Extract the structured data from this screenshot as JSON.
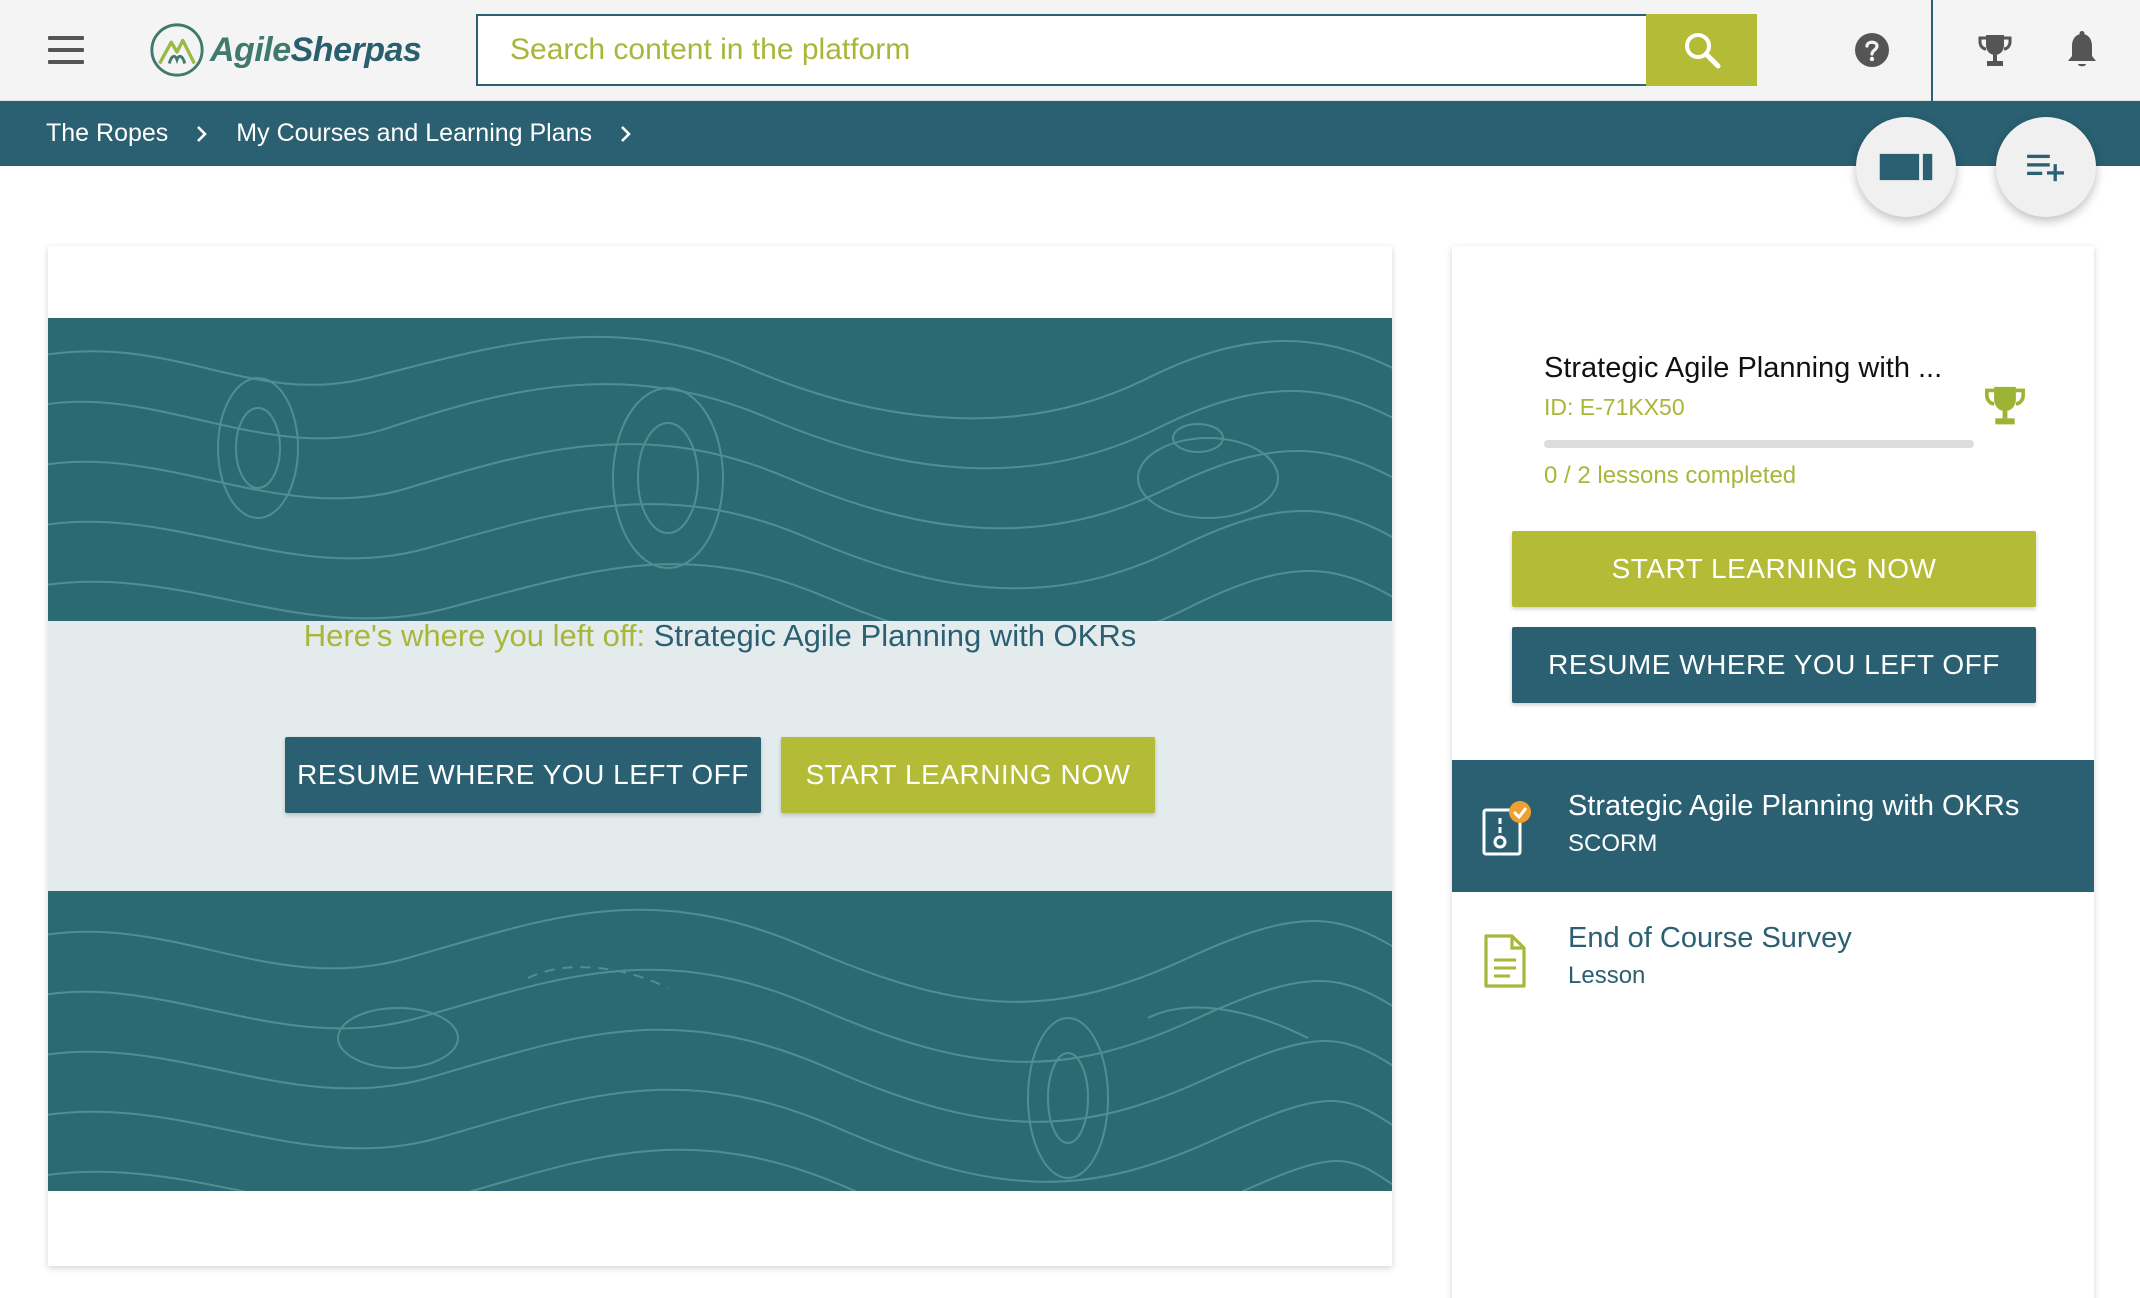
{
  "brand": {
    "name_part1": "Agile",
    "name_part2": "Sherpas"
  },
  "search": {
    "placeholder": "Search content in the platform"
  },
  "colors": {
    "teal": "#2a6072",
    "lime": "#b3bb37",
    "lime_text": "#a8b63a"
  },
  "icons": {
    "menu": "hamburger-menu-icon",
    "search": "magnifier-icon",
    "help": "question-circle-icon",
    "achievements": "trophy-icon",
    "notifications": "bell-icon",
    "theater": "video-rectangle-icon",
    "playlist": "playlist-add-icon",
    "scorm": "scorm-package-icon",
    "lesson": "document-icon"
  },
  "breadcrumb": {
    "items": [
      {
        "label": "The Ropes"
      },
      {
        "label": "My Courses and Learning Plans"
      }
    ]
  },
  "banner": {
    "leftoff_label": "Here's where you left off:",
    "leftoff_course": "Strategic Agile Planning with OKRs",
    "resume_label": "RESUME WHERE YOU LEFT OFF",
    "start_label": "START LEARNING NOW"
  },
  "course": {
    "title": "Strategic Agile Planning with ...",
    "id_text": "ID: E-71KX50",
    "lessons_completed_text": "0 / 2 lessons completed",
    "progress_fraction": 0,
    "start_label": "START LEARNING NOW",
    "resume_label": "RESUME WHERE YOU LEFT OFF"
  },
  "lessons": [
    {
      "title": "Strategic Agile Planning with OKRs",
      "type": "SCORM",
      "active": true
    },
    {
      "title": "End of Course Survey",
      "type": "Lesson",
      "active": false
    }
  ]
}
